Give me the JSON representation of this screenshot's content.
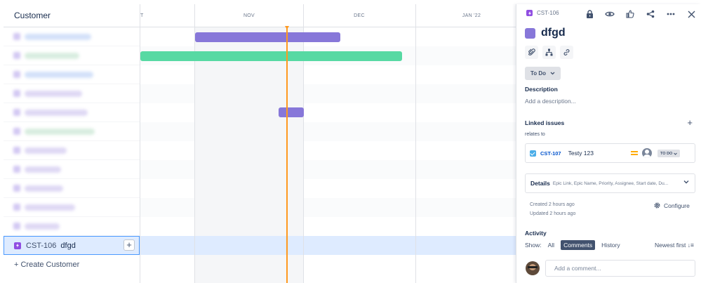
{
  "list": {
    "header": "Customer",
    "selected": {
      "key": "CST-106",
      "name": "dfgd"
    },
    "create_label": "+ Create Customer"
  },
  "timeline": {
    "months": [
      "T",
      "NOV",
      "DEC",
      "JAN '22"
    ]
  },
  "panel": {
    "issue_key": "CST-106",
    "title": "dfgd",
    "status": "To Do",
    "description_label": "Description",
    "description_placeholder": "Add a description...",
    "linked_issues_label": "Linked issues",
    "relates_to": "relates to",
    "linked_issue": {
      "key": "CST-107",
      "name": "Testy 123",
      "status": "TO DO"
    },
    "details_label": "Details",
    "details_fields": "Epic Link, Epic Name, Priority, Assignee, Start date, Du...",
    "created": "Created 2 hours ago",
    "updated": "Updated 2 hours ago",
    "configure_label": "Configure",
    "activity_label": "Activity",
    "show_label": "Show:",
    "filters": [
      "All",
      "Comments",
      "History"
    ],
    "sort_label": "Newest first",
    "comment_placeholder": "Add a comment..."
  },
  "colors": {
    "epic_purple": "#8777d9",
    "bar_green": "#57d9a3",
    "today_line": "#ff991f",
    "selected_row": "#deebff"
  }
}
